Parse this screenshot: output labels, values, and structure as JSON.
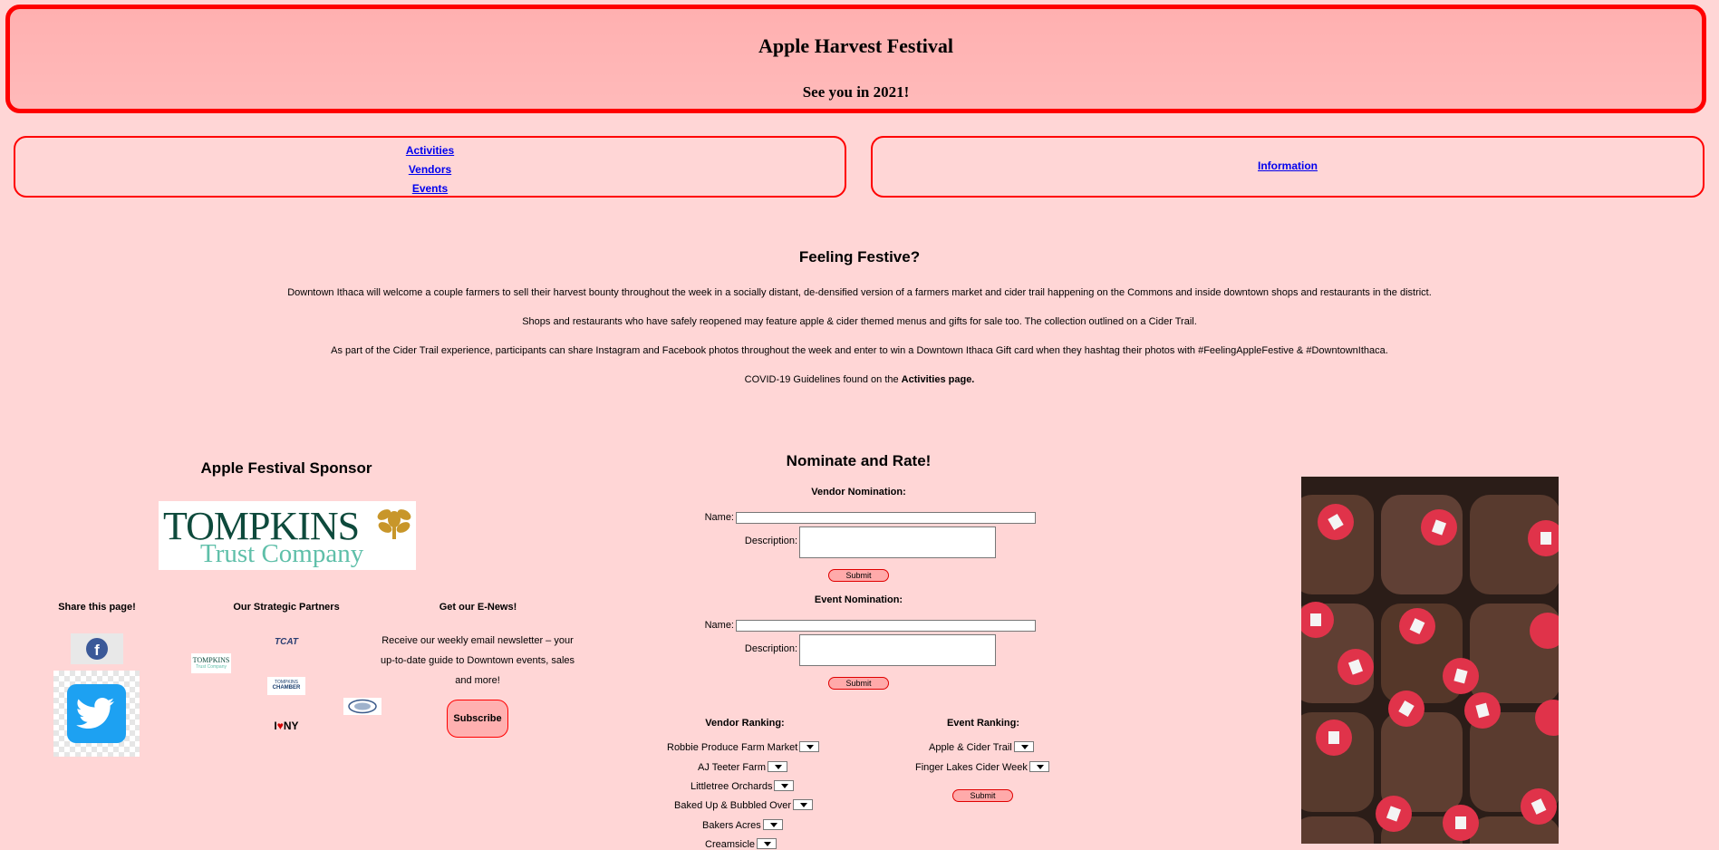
{
  "header": {
    "title": "Apple Harvest Festival",
    "subtitle": "See you in 2021!"
  },
  "nav": {
    "left": [
      "Activities",
      "Vendors",
      "Events"
    ],
    "right": [
      "Information"
    ]
  },
  "festive": {
    "title": "Feeling Festive?",
    "p1": "Downtown Ithaca will welcome a couple farmers to sell their harvest bounty throughout the week in a socially distant, de-densified version of a farmers market and cider trail happening on the Commons and inside downtown shops and restaurants in the district.",
    "p2": "Shops and restaurants who have safely reopened may feature apple & cider themed menus and gifts for sale too. The collection outlined on a Cider Trail.",
    "p3": "As part of the Cider Trail experience, participants can share Instagram and Facebook photos throughout the week and enter to win a Downtown Ithaca Gift card when they hashtag their photos with #FeelingAppleFestive & #DowntownIthaca.",
    "p4_prefix": "COVID-19 Guidelines found on the ",
    "p4_link": "Activities page."
  },
  "sponsor": {
    "title": "Apple Festival Sponsor",
    "logo_line1": "TOMPKINS",
    "logo_line2": "Trust Company"
  },
  "share": {
    "title": "Share this page!",
    "facebook_icon": "facebook-icon",
    "twitter_icon": "twitter-icon"
  },
  "partners": {
    "title": "Our Strategic Partners",
    "logos": [
      "TOMPKINS",
      "Trust Company",
      "TCAT",
      "TOMPKINS",
      "CHAMBER",
      "I",
      "NY"
    ]
  },
  "enews": {
    "title": "Get our E-News!",
    "text": "Receive our weekly email newsletter – your up-to-date guide to Downtown events, sales and more!",
    "button": "Subscribe"
  },
  "nominate": {
    "title": "Nominate and Rate!",
    "vendor_form": {
      "title": "Vendor Nomination:",
      "name_label": "Name:",
      "desc_label": "Description:",
      "submit": "Submit"
    },
    "event_form": {
      "title": "Event Nomination:",
      "name_label": "Name:",
      "desc_label": "Description:",
      "submit": "Submit"
    },
    "vendor_ranking": {
      "title": "Vendor Ranking:",
      "items": [
        "Robbie Produce Farm Market",
        "AJ Teeter Farm",
        "Littletree Orchards",
        "Baked Up & Bubbled Over",
        "Bakers Acres",
        "Creamsicle"
      ]
    },
    "event_ranking": {
      "title": "Event Ranking:",
      "items": [
        "Apple & Cider Trail",
        "Finger Lakes Cider Week"
      ],
      "submit": "Submit"
    }
  },
  "colors": {
    "background": "#ffd6d6",
    "border": "#ff0000",
    "header_bg": "#ffb0b0",
    "link": "#0000ee"
  }
}
